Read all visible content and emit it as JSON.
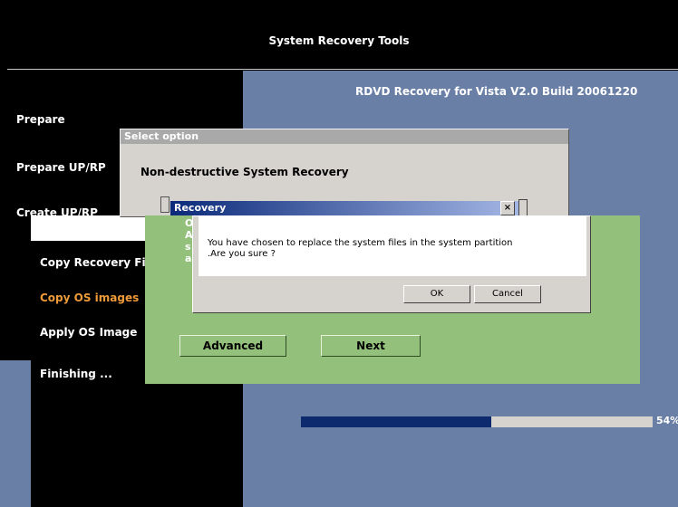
{
  "header": {
    "title": "System Recovery Tools"
  },
  "version": "RDVD Recovery for Vista V2.0 Build 20061220",
  "steps": [
    {
      "label": "Prepare"
    },
    {
      "label": "Prepare UP/RP"
    },
    {
      "label": "Create UP/RP"
    },
    {
      "label": "Copy Recovery File"
    },
    {
      "label": "Copy OS images"
    },
    {
      "label": "Apply OS Image"
    },
    {
      "label": "Finishing ..."
    }
  ],
  "select_dialog": {
    "title": "Select option",
    "heading": "Non-destructive System Recovery",
    "advanced_label": "Advanced",
    "next_label": "Next",
    "side_text": "O A s a"
  },
  "recovery_dialog": {
    "title": "Recovery",
    "close_glyph": "×",
    "message": "You have chosen to replace the system files in the system  partition .Are you sure ?",
    "ok_label": "OK",
    "cancel_label": "Cancel"
  },
  "progress": {
    "value": 0.54,
    "label": "54%"
  },
  "colors": {
    "background": "#000000",
    "panel_blue": "#6a7fa6",
    "active_step": "#ef9a3a",
    "green_panel": "#93c17b",
    "progress_fill": "#0d2a6f"
  }
}
